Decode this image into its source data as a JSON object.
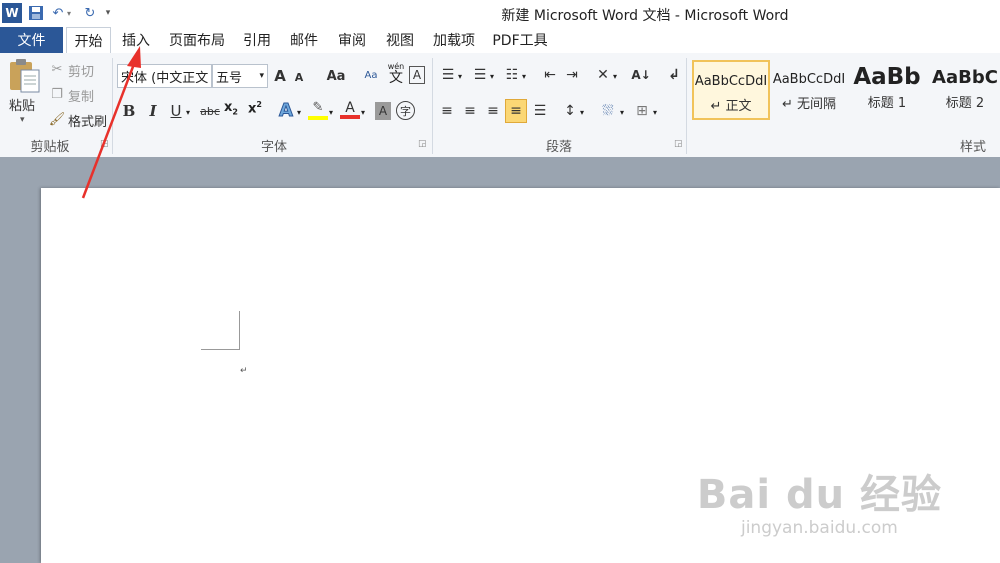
{
  "window": {
    "title": "新建 Microsoft Word 文档 - Microsoft Word",
    "qat": {
      "app_icon": "W",
      "save_icon": "save-icon",
      "undo_icon": "undo-icon",
      "redo_icon": "redo-icon",
      "customize_icon": "customize-qat-icon"
    }
  },
  "tabs": {
    "file": "文件",
    "items": [
      "开始",
      "插入",
      "页面布局",
      "引用",
      "邮件",
      "审阅",
      "视图",
      "加载项",
      "PDF工具"
    ],
    "active": "开始"
  },
  "ribbon": {
    "clipboard": {
      "label": "剪贴板",
      "paste": "粘贴",
      "cut": "剪切",
      "copy": "复制",
      "format_painter": "格式刷"
    },
    "font": {
      "label": "字体",
      "font_name": "宋体 (中文正文",
      "font_size": "五号",
      "grow": "A",
      "shrink": "A",
      "change_case": "Aa",
      "pinyin": "wén",
      "pinyin_char": "文",
      "border_char": "A",
      "bold": "B",
      "italic": "I",
      "underline": "U",
      "strike": "abc",
      "subscript": "x",
      "superscript": "x",
      "text_effect": "A",
      "font_color": "A",
      "shading": "A",
      "enclose": "字"
    },
    "paragraph": {
      "label": "段落"
    },
    "styles": {
      "label": "样式",
      "items": [
        {
          "sample": "AaBbCcDdI",
          "name": "↵ 正文"
        },
        {
          "sample": "AaBbCcDdI",
          "name": "↵ 无间隔"
        },
        {
          "sample": "AaBb",
          "name": "标题 1"
        },
        {
          "sample": "AaBbC",
          "name": "标题 2"
        }
      ]
    }
  },
  "document": {
    "paragraph_mark": "↵"
  },
  "watermark": {
    "logo": "Bai du 经验",
    "url": "jingyan.baidu.com"
  },
  "annotation_color": "#e8312b",
  "accent_color": "#2b5797"
}
